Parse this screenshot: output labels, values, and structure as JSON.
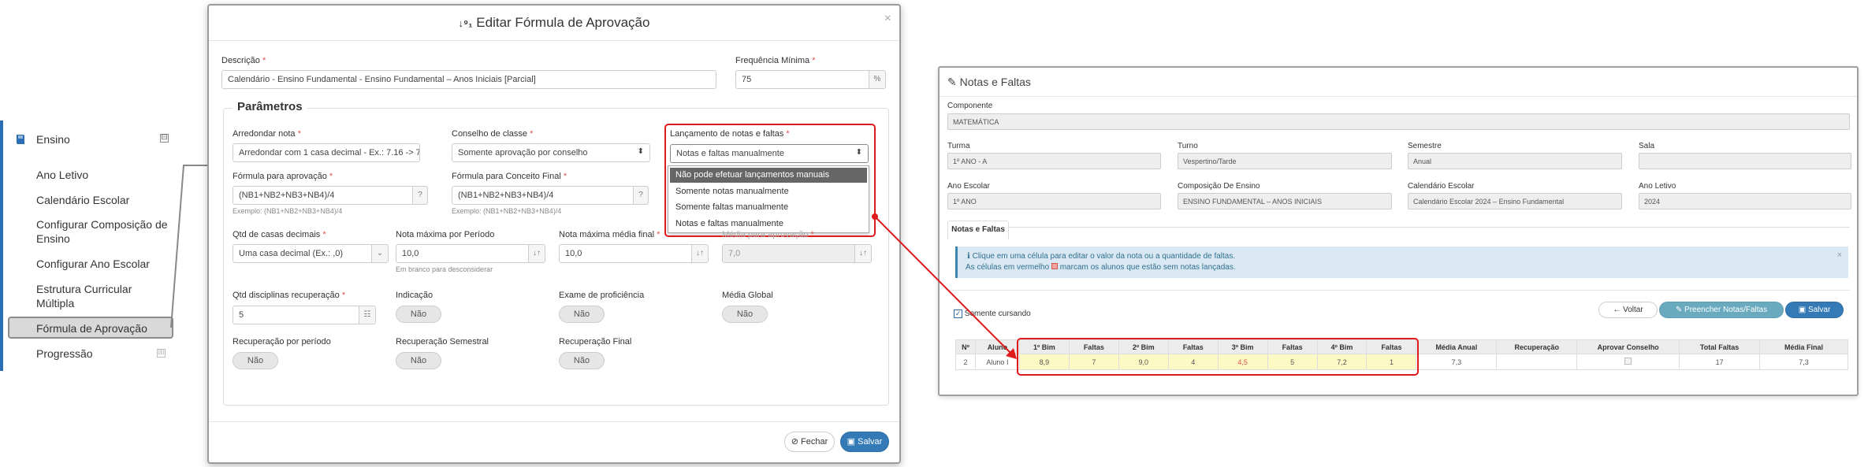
{
  "sidebar": {
    "section": "Ensino",
    "collapse_symbol": "⊟",
    "items": [
      {
        "label": "Ano Letivo"
      },
      {
        "label": "Calendário Escolar"
      },
      {
        "label": "Configurar Composição de Ensino"
      },
      {
        "label": "Configurar Ano Escolar"
      },
      {
        "label": "Estrutura Curricular Múltipla"
      },
      {
        "label": "Fórmula de Aprovação"
      },
      {
        "label": "Progressão"
      }
    ],
    "active_item": "Fórmula de Aprovação",
    "sub_collapse_symbol": "⊞"
  },
  "modal": {
    "title": "Editar Fórmula de Aprovação",
    "close": "×",
    "descricao_label": "Descrição",
    "descricao_value": "Calendário - Ensino Fundamental - Ensino Fundamental – Anos Iniciais [Parcial]",
    "freq_label": "Frequência Mínima",
    "freq_value": "75",
    "freq_unit": "%",
    "parametros": "Parâmetros",
    "arredondar_label": "Arredondar nota",
    "arredondar_value": "Arredondar com 1 casa decimal - Ex.: 7.16 -> 7.",
    "conselho_label": "Conselho de classe",
    "conselho_value": "Somente aprovação por conselho",
    "lancamento_label": "Lançamento de notas e faltas",
    "lancamento_value": "Notas e faltas manualmente",
    "lancamento_options": [
      "Não pode efetuar lançamentos manuais",
      "Somente notas manualmente",
      "Somente faltas manualmente",
      "Notas e faltas manualmente"
    ],
    "formula_aprov_label": "Fórmula para aprovação",
    "formula_aprov_value": "(NB1+NB2+NB3+NB4)/4",
    "formula_aprov_hint": "Exemplo: (NB1+NB2+NB3+NB4)/4",
    "formula_conceito_label": "Fórmula para Conceito Final",
    "formula_conceito_value": "(NB1+NB2+NB3+NB4)/4",
    "formula_conceito_hint": "Exemplo: (NB1+NB2+NB3+NB4)/4",
    "qtd_casas_label": "Qtd de casas decimais",
    "qtd_casas_value": "Uma casa decimal (Ex.: ,0)",
    "nota_max_periodo_label": "Nota máxima por Período",
    "nota_max_periodo_value": "10,0",
    "nota_max_periodo_hint": "Em branco para desconsiderar",
    "nota_max_media_label": "Nota máxima média final",
    "nota_max_media_value": "10,0",
    "media_aprov_label": "Média para aprovação",
    "media_aprov_value": "7,0",
    "qtd_disc_label": "Qtd disciplinas recuperação",
    "qtd_disc_value": "5",
    "indicacao_label": "Indicação",
    "exame_label": "Exame de proficiência",
    "media_global_label": "Média Global",
    "rec_periodo_label": "Recuperação por período",
    "rec_semestral_label": "Recuperação Semestral",
    "rec_final_label": "Recuperação Final",
    "toggle_no": "Não",
    "fechar": "Fechar",
    "salvar": "Salvar"
  },
  "panel": {
    "title": "Notas e Faltas",
    "componente_label": "Componente",
    "componente_value": "MATEMÁTICA",
    "turma_label": "Turma",
    "turma_value": "1º ANO - A",
    "turno_label": "Turno",
    "turno_value": "Vespertino/Tarde",
    "semestre_label": "Semestre",
    "semestre_value": "Anual",
    "sala_label": "Sala",
    "sala_value": "",
    "ano_escolar_label": "Ano Escolar",
    "ano_escolar_value": "1º ANO",
    "composicao_label": "Composição De Ensino",
    "composicao_value": "ENSINO FUNDAMENTAL – ANOS INICIAIS",
    "calendario_label": "Calendário Escolar",
    "calendario_value": "Calendário Escolar 2024 – Ensino Fundamental",
    "ano_letivo_label": "Ano Letivo",
    "ano_letivo_value": "2024",
    "tab": "Notas e Faltas",
    "alert_line1": "Clique em uma célula para editar o valor da nota ou a quantidade de faltas.",
    "alert_line2a": "As células em vermelho",
    "alert_line2b": "marcam os alunos que estão sem notas lançadas.",
    "somente_cursando": "Somente cursando",
    "voltar": "Voltar",
    "preencher": "Preencher Notas/Faltas",
    "salvar": "Salvar",
    "columns": [
      "Nº",
      "Aluno",
      "1º Bim",
      "Faltas",
      "2º Bim",
      "Faltas",
      "3º Bim",
      "Faltas",
      "4º Bim",
      "Faltas",
      "Média Anual",
      "Recuperação",
      "Aprovar Conselho",
      "Total Faltas",
      "Média Final"
    ],
    "row": [
      "2",
      "Aluno I",
      "8,9",
      "7",
      "9,0",
      "4",
      "4,5",
      "5",
      "7,2",
      "1",
      "7,3",
      "",
      "",
      "17",
      "7,3"
    ]
  },
  "colors": {
    "accent": "#337ab7",
    "highlight": "#e0191a",
    "sidebar_bar": "#2a6fb5",
    "cell_yellow": "#fdf9c4"
  }
}
